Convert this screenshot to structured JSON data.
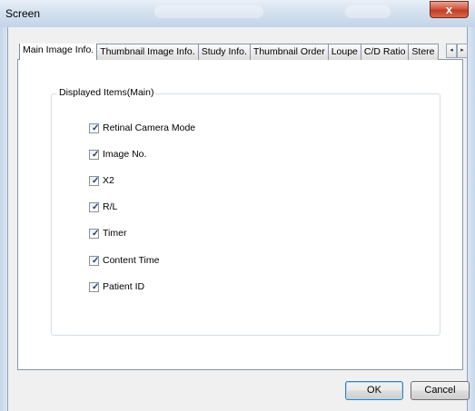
{
  "window": {
    "title": "Screen",
    "close_glyph": "x"
  },
  "tabs": [
    {
      "label": "Main Image Info.",
      "active": true
    },
    {
      "label": "Thumbnail Image Info.",
      "active": false
    },
    {
      "label": "Study Info.",
      "active": false
    },
    {
      "label": "Thumbnail Order",
      "active": false
    },
    {
      "label": "Loupe",
      "active": false
    },
    {
      "label": "C/D Ratio",
      "active": false
    },
    {
      "label": "Stere",
      "active": false
    }
  ],
  "tab_scroll": {
    "left_glyph": "◂",
    "right_glyph": "▸"
  },
  "group": {
    "title": "Displayed Items(Main)",
    "items": [
      {
        "label": "Retinal Camera Mode",
        "checked": true
      },
      {
        "label": "Image No.",
        "checked": true
      },
      {
        "label": "X2",
        "checked": true
      },
      {
        "label": "R/L",
        "checked": true
      },
      {
        "label": "Timer",
        "checked": true
      },
      {
        "label": "Content Time",
        "checked": true
      },
      {
        "label": "Patient ID",
        "checked": true
      }
    ]
  },
  "checkmark_glyph": "✓",
  "buttons": {
    "ok": "OK",
    "cancel": "Cancel"
  }
}
